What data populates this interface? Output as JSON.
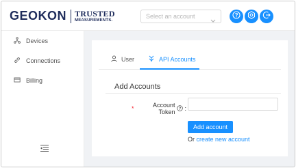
{
  "header": {
    "logo_main": "GEOKON",
    "logo_trusted": "TRUSTED",
    "logo_measurements": "MEASUREMENTS.",
    "account_select": {
      "placeholder": "Select an account"
    },
    "icons": [
      "help-icon",
      "settings-icon",
      "logout-icon"
    ],
    "accent_color": "#1890ff"
  },
  "sidebar": {
    "items": [
      {
        "label": "Devices",
        "icon": "devices-icon"
      },
      {
        "label": "Connections",
        "icon": "link-icon"
      },
      {
        "label": "Billing",
        "icon": "credit-card-icon"
      }
    ],
    "collapse_icon": "menu-fold-icon"
  },
  "main": {
    "tabs": [
      {
        "label": "User",
        "icon": "user-icon",
        "active": false
      },
      {
        "label": "API Accounts",
        "icon": "api-icon",
        "active": true
      }
    ],
    "section_title": "Add Accounts",
    "form": {
      "token_label": "Account Token",
      "token_required_mark": "*",
      "token_separator": ":",
      "token_value": "",
      "submit_label": "Add account",
      "alt_prefix": "Or",
      "alt_link_label": "create new account"
    }
  }
}
